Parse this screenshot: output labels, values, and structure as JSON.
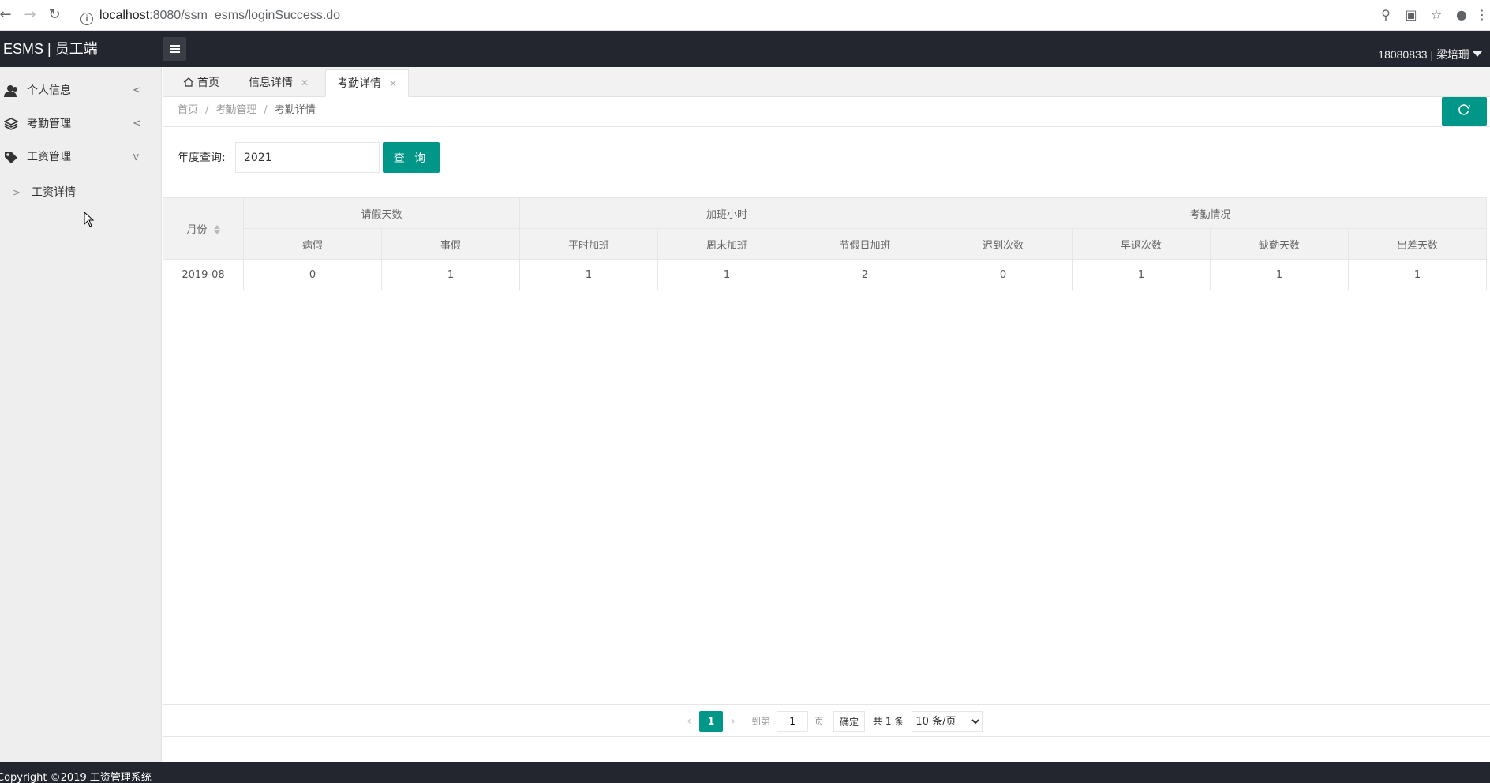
{
  "browser": {
    "url_host": "localhost",
    "url_rest": ":8080/ssm_esms/loginSuccess.do"
  },
  "header": {
    "logo": "ESMS | 员工端",
    "user": "18080833 | 梁培珊"
  },
  "sidebar": {
    "items": [
      {
        "label": "个人信息",
        "icon": "user-icon"
      },
      {
        "label": "考勤管理",
        "icon": "layers-icon"
      },
      {
        "label": "工资管理",
        "icon": "tag-icon"
      }
    ],
    "sub_items": [
      {
        "label": "工资详情"
      }
    ]
  },
  "tabs": [
    {
      "label": "首页"
    },
    {
      "label": "信息详情"
    },
    {
      "label": "考勤详情"
    }
  ],
  "breadcrumb": [
    "首页",
    "考勤管理",
    "考勤详情"
  ],
  "search": {
    "label": "年度查询:",
    "value": "2021",
    "button": "查 询"
  },
  "table": {
    "month_header": "月份",
    "groups": [
      "请假天数",
      "加班小时",
      "考勤情况"
    ],
    "sub_headers": [
      "病假",
      "事假",
      "平时加班",
      "周末加班",
      "节假日加班",
      "迟到次数",
      "早退次数",
      "缺勤天数",
      "出差天数"
    ],
    "rows": [
      [
        "2019-08",
        "0",
        "1",
        "1",
        "1",
        "2",
        "0",
        "1",
        "1",
        "1"
      ]
    ]
  },
  "pager": {
    "current": "1",
    "goto_label": "到第",
    "goto_value": "1",
    "page_unit": "页",
    "confirm": "确定",
    "total": "共 1 条",
    "page_size": "10 条/页"
  },
  "footer": "Copyright ©2019 工资管理系统",
  "colors": {
    "accent": "#009688",
    "header_bg": "#23262e",
    "sidebar_bg": "#eeeeee"
  }
}
